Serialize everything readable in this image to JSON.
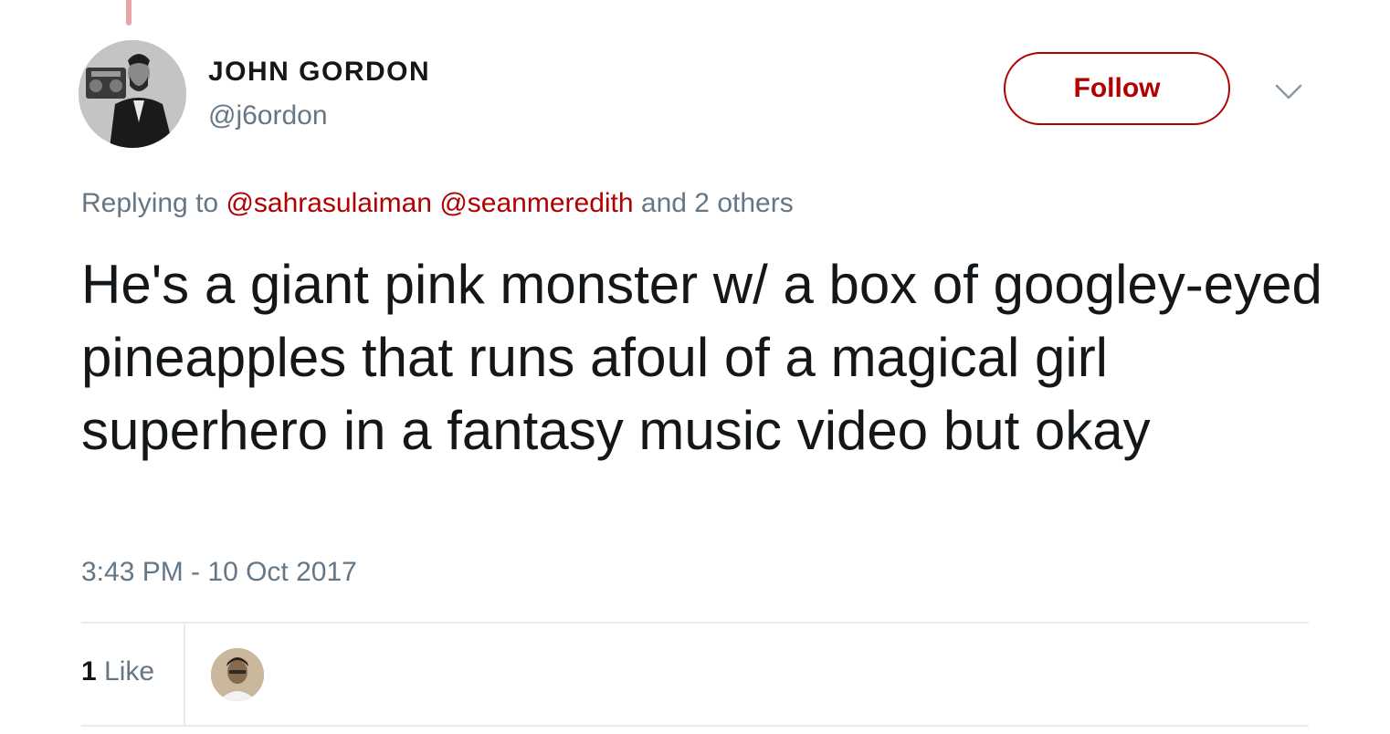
{
  "author": {
    "display_name": "JOHN GORDON",
    "handle": "@j6ordon"
  },
  "follow_button_label": "Follow",
  "replying": {
    "prefix": "Replying to",
    "mentions": [
      "@sahrasulaiman",
      "@seanmeredith"
    ],
    "suffix": "and 2 others"
  },
  "tweet_text": "He's a giant pink monster w/ a box of googley-eyed pineapples that runs afoul of a magical girl superhero in a fantasy music video but okay",
  "timestamp": "3:43 PM - 10 Oct 2017",
  "stats": {
    "like_count": "1",
    "like_label": "Like"
  },
  "icons": {
    "menu": "chevron-down-icon",
    "avatar": "author-avatar",
    "liker": "liker-avatar"
  },
  "colors": {
    "accent": "#b00000",
    "muted_text": "#657786",
    "primary_text": "#14171a",
    "divider": "#e6ecf0"
  }
}
